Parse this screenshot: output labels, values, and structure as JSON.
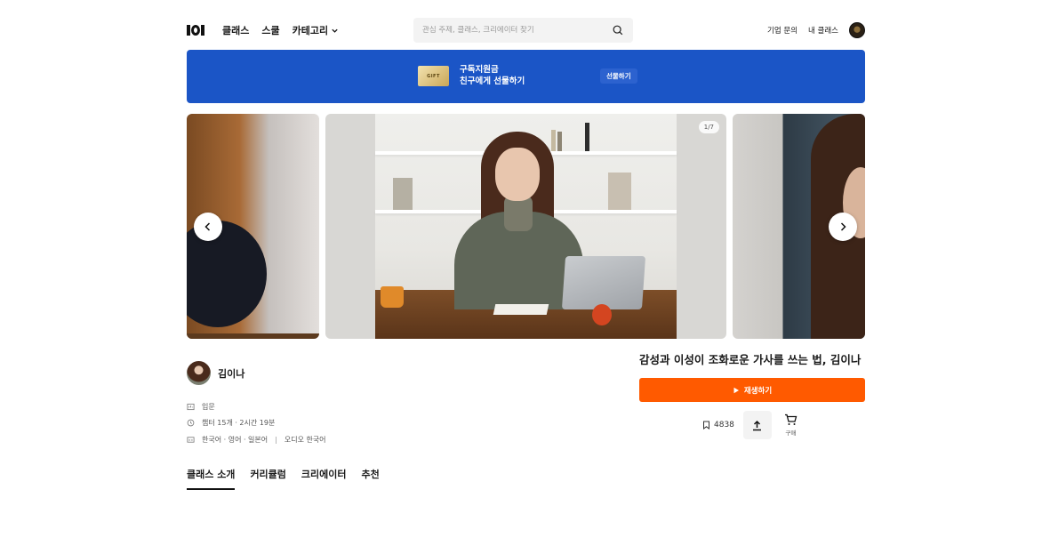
{
  "header": {
    "nav": [
      "클래스",
      "스쿨",
      "카테고리"
    ],
    "search_placeholder": "관심 주제, 클래스, 크리에이터 찾기",
    "links": [
      "기업 문의",
      "내 클래스"
    ]
  },
  "banner": {
    "gift_label": "GIFT",
    "line1": "구독지원금",
    "line2": "친구에게 선물하기",
    "button": "선물하기",
    "color": "#1b55c6"
  },
  "carousel": {
    "counter": "1/7"
  },
  "creator": {
    "name": "김이나"
  },
  "meta": {
    "level": "입문",
    "duration": "챕터 15개 · 2시간 19분",
    "languages": "한국어 · 영어 · 일본어",
    "audio": "오디오 한국어"
  },
  "tabs": [
    "클래스 소개",
    "커리큘럼",
    "크리에이터",
    "추천"
  ],
  "class": {
    "title": "감성과 이성이 조화로운 가사를 쓰는 법, 김이나",
    "play": "재생하기",
    "bookmark_count": "4838",
    "buy": "구매",
    "accent": "#ff5a00"
  },
  "icons": [
    "logo-icon",
    "chevron-down-icon",
    "search-icon",
    "avatar-icon",
    "chevron-left-icon",
    "chevron-right-icon",
    "level-icon",
    "clock-icon",
    "subtitle-icon",
    "play-icon",
    "bookmark-icon",
    "share-icon",
    "cart-icon"
  ]
}
